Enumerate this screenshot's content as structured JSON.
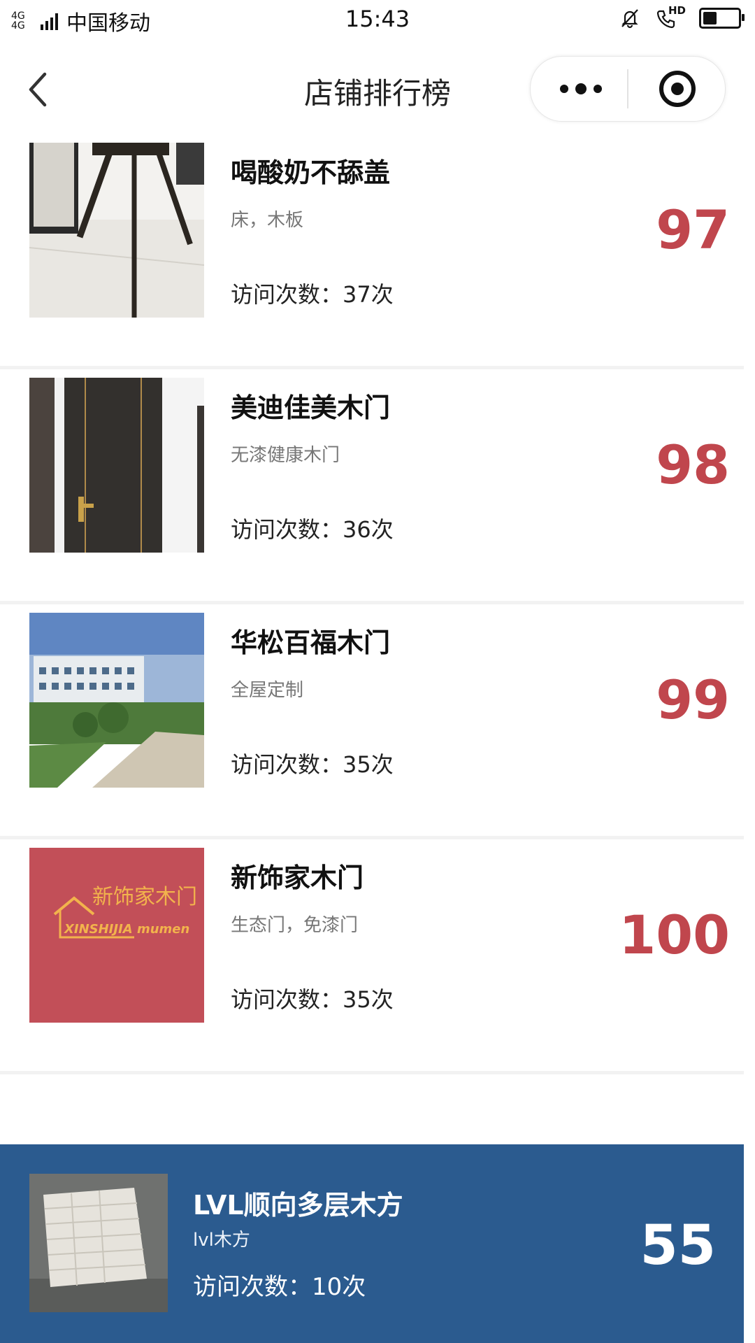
{
  "status_bar": {
    "network": "4G 4G",
    "carrier": "中国移动",
    "time": "15:43",
    "hd_label": "HD",
    "battery_level": 0.35
  },
  "nav": {
    "title": "店铺排行榜"
  },
  "shops": [
    {
      "name": "喝酸奶不舔盖",
      "tags": "床，木板",
      "visits": "访问次数：37次",
      "score": "97"
    },
    {
      "name": "美迪佳美木门",
      "tags": "无漆健康木门",
      "visits": "访问次数：36次",
      "score": "98"
    },
    {
      "name": "华松百福木门",
      "tags": "全屋定制",
      "visits": "访问次数：35次",
      "score": "99"
    },
    {
      "name": "新饰家木门",
      "tags": "生态门，免漆门",
      "visits": "访问次数：35次",
      "score": "100",
      "logo_text": "新饰家木门",
      "logo_subtext": "XINSHIJIA mumen"
    }
  ],
  "my_shop": {
    "name": "LVL顺向多层木方",
    "tags": "lvl木方",
    "visits": "访问次数：10次",
    "score": "55"
  },
  "colors": {
    "score_red": "#c0464d",
    "bottom_bar_blue": "#2b5b8f",
    "logo_red": "#c24f58",
    "logo_gold": "#f2b34c"
  }
}
